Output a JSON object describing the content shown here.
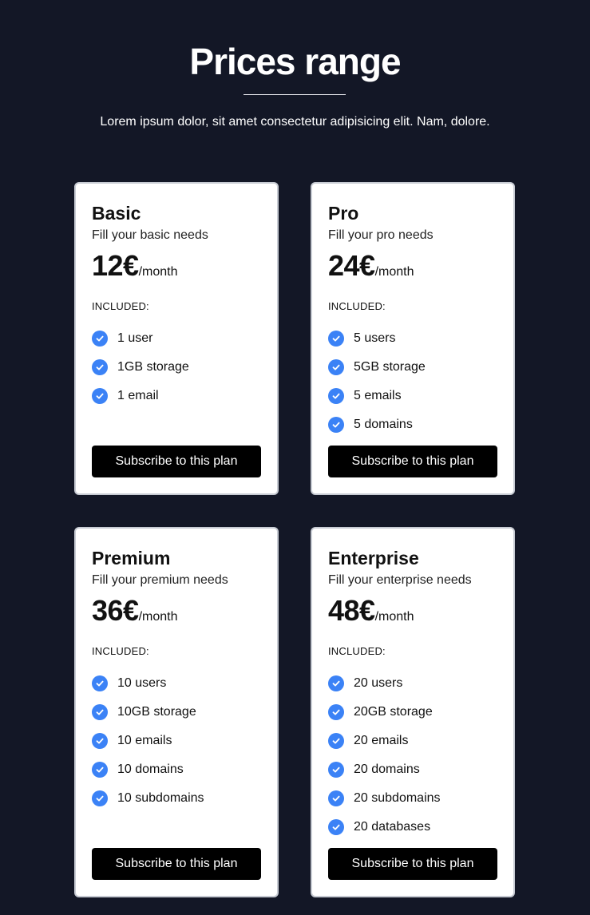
{
  "header": {
    "title": "Prices range",
    "subtitle": "Lorem ipsum dolor, sit amet consectetur adipisicing elit. Nam, dolore."
  },
  "included_label": "INCLUDED:",
  "button_label": "Subscribe to this plan",
  "accent_color": "#3b82f6",
  "plans": [
    {
      "name": "Basic",
      "description": "Fill your basic needs",
      "price": "12€",
      "period": "/month",
      "features": [
        "1 user",
        "1GB storage",
        "1 email"
      ]
    },
    {
      "name": "Pro",
      "description": "Fill your pro needs",
      "price": "24€",
      "period": "/month",
      "features": [
        "5 users",
        "5GB storage",
        "5 emails",
        "5 domains"
      ]
    },
    {
      "name": "Premium",
      "description": "Fill your premium needs",
      "price": "36€",
      "period": "/month",
      "features": [
        "10 users",
        "10GB storage",
        "10 emails",
        "10 domains",
        "10 subdomains"
      ]
    },
    {
      "name": "Enterprise",
      "description": "Fill your enterprise needs",
      "price": "48€",
      "period": "/month",
      "features": [
        "20 users",
        "20GB storage",
        "20 emails",
        "20 domains",
        "20 subdomains",
        "20 databases"
      ]
    }
  ]
}
